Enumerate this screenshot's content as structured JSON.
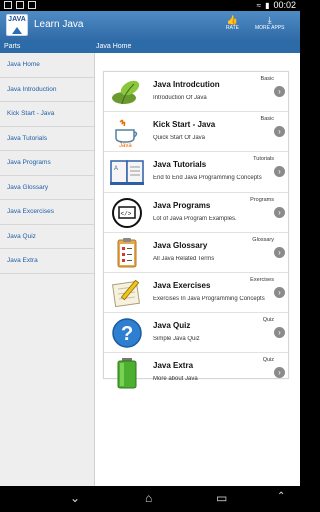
{
  "status": {
    "time": "00:02"
  },
  "app": {
    "icon_text": "JAVA",
    "title": "Learn Java",
    "rate_label": "RATE",
    "more_apps_label": "MORE APPS"
  },
  "sections": {
    "left": "Parts",
    "right": "Java Home"
  },
  "sidebar": {
    "items": [
      "Java Home",
      "Java Introduction",
      "Kick Start - Java",
      "Java Tutorials",
      "Java Programs",
      "Java Glossary",
      "Java Excercises",
      "Java Quiz",
      "Java Extra"
    ]
  },
  "list": {
    "items": [
      {
        "title": "Java Introdcution",
        "desc": "Introduction Of Java",
        "tag": "Basic"
      },
      {
        "title": "Kick Start - Java",
        "desc": "Quick Start Of Java",
        "tag": "Basic"
      },
      {
        "title": "Java Tutorials",
        "desc": "End to End Java Programming Concepts",
        "tag": "Tutorials"
      },
      {
        "title": "Java Programs",
        "desc": "Lot of Java Program Examples.",
        "tag": "Programs"
      },
      {
        "title": "Java Glossary",
        "desc": "All Java Related Terms",
        "tag": "Glossary"
      },
      {
        "title": "Java Exercises",
        "desc": "Exercises In Java Programming Concepts",
        "tag": "Exercises"
      },
      {
        "title": "Java Quiz",
        "desc": "Simple Java Quiz",
        "tag": "Quiz"
      },
      {
        "title": "Java Extra",
        "desc": "More about Java",
        "tag": "Quiz"
      }
    ]
  }
}
